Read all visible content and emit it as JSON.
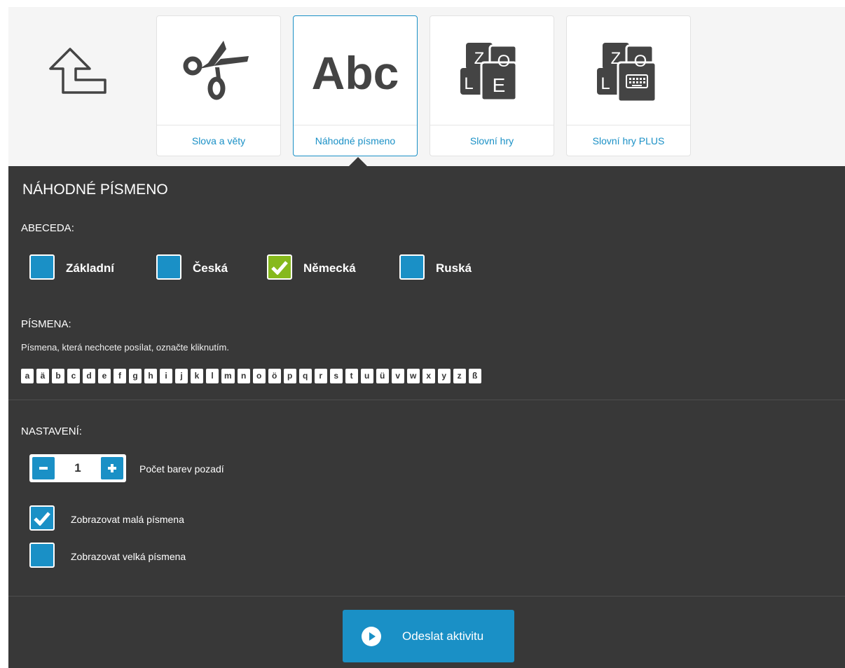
{
  "nav": {
    "back_icon": "arrow-back-icon",
    "cards": [
      {
        "label": "Slova a věty",
        "icon": "scissors-icon"
      },
      {
        "label": "Náhodné písmeno",
        "icon": "abc-icon",
        "icon_text": "Abc",
        "active": true
      },
      {
        "label": "Slovní hry",
        "icon": "letter-tiles-icon",
        "tiles": [
          "Z",
          "O",
          "L",
          "E"
        ]
      },
      {
        "label": "Slovní hry PLUS",
        "icon": "letter-tiles-keyboard-icon",
        "tiles": [
          "Z",
          "O",
          "L"
        ]
      }
    ]
  },
  "panel": {
    "title": "NÁHODNÉ PÍSMENO",
    "alphabet_heading": "ABECEDA:",
    "alphabets": [
      {
        "label": "Základní",
        "checked": false
      },
      {
        "label": "Česká",
        "checked": false
      },
      {
        "label": "Německá",
        "checked": true
      },
      {
        "label": "Ruská",
        "checked": false
      }
    ],
    "letters_heading": "PÍSMENA:",
    "letters_hint": "Písmena, která nechcete posílat, označte kliknutím.",
    "letters": [
      "a",
      "ä",
      "b",
      "c",
      "d",
      "e",
      "f",
      "g",
      "h",
      "i",
      "j",
      "k",
      "l",
      "m",
      "n",
      "o",
      "ö",
      "p",
      "q",
      "r",
      "s",
      "t",
      "u",
      "ü",
      "v",
      "w",
      "x",
      "y",
      "z",
      "ß"
    ],
    "settings_heading": "NASTAVENÍ:",
    "bg_colors": {
      "value": "1",
      "label": "Počet barev pozadí"
    },
    "options": [
      {
        "label": "Zobrazovat malá písmena",
        "checked": true
      },
      {
        "label": "Zobrazovat velká písmena",
        "checked": false
      }
    ],
    "send_label": "Odeslat aktivitu"
  },
  "colors": {
    "accent": "#1a90c6",
    "panel": "#383838",
    "checked": "#86b91c"
  }
}
